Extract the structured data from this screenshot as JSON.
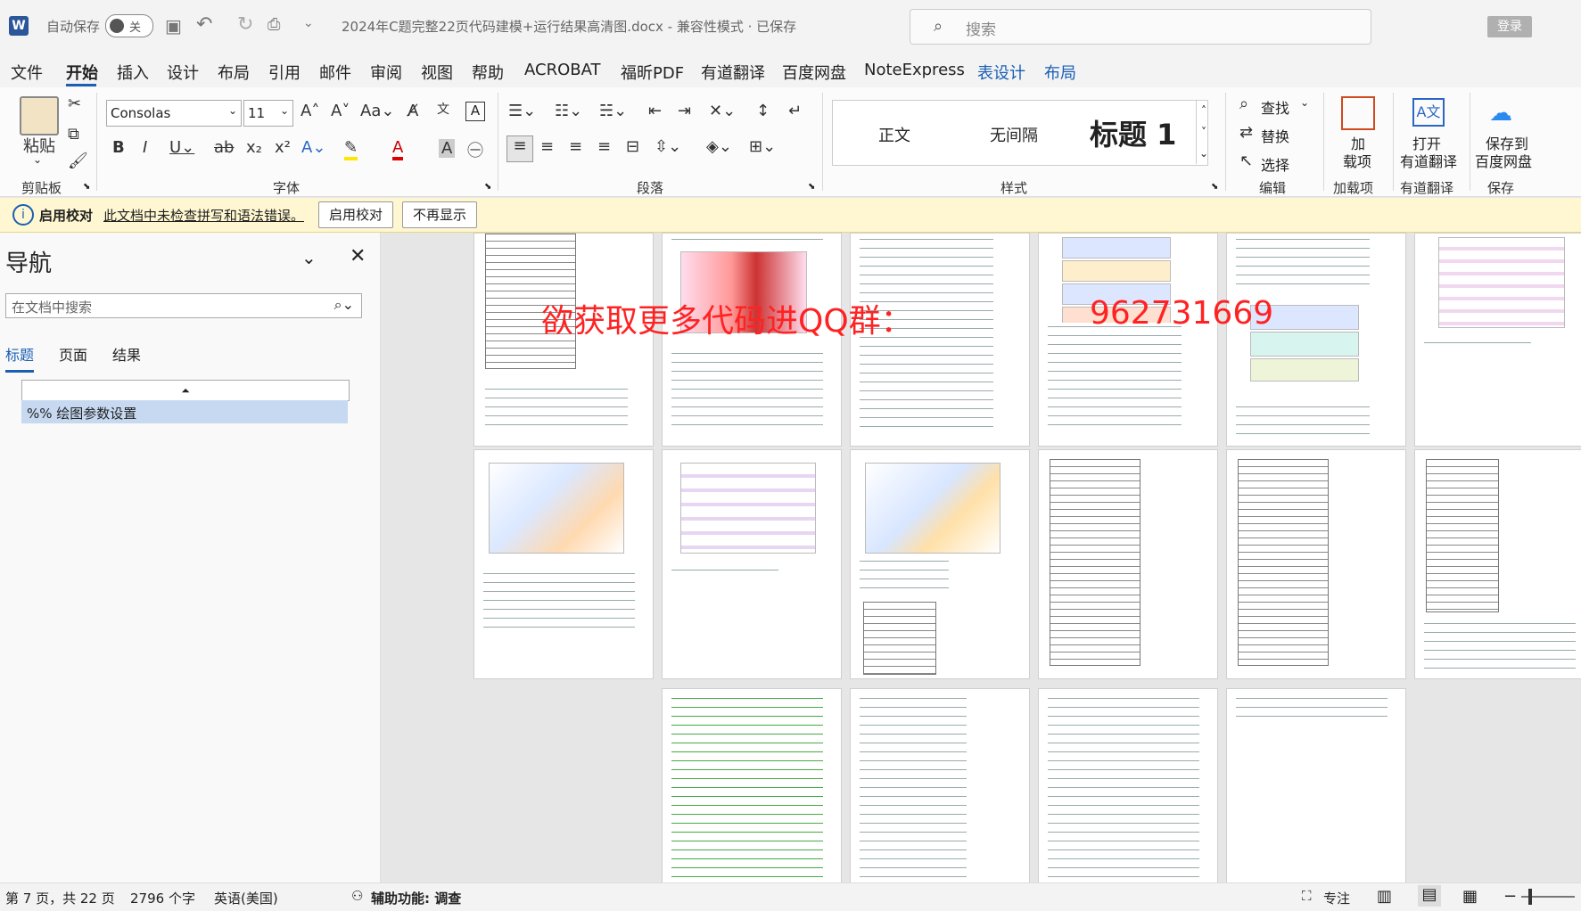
{
  "titlebar": {
    "app_icon": "W",
    "autosave_label": "自动保存",
    "autosave_state": "关",
    "doc_title": "2024年C题完整22页代码建模+运行结果高清图.docx  -  兼容性模式 · 已保存",
    "search_placeholder": "搜索",
    "login": "登录"
  },
  "menu": [
    "文件",
    "开始",
    "插入",
    "设计",
    "布局",
    "引用",
    "邮件",
    "审阅",
    "视图",
    "帮助",
    "ACROBAT",
    "福昕PDF",
    "有道翻译",
    "百度网盘",
    "NoteExpress",
    "表设计",
    "布局"
  ],
  "ribbon": {
    "paste": "粘贴",
    "clipboard_group": "剪贴板",
    "font_name": "Consolas",
    "font_size": "11",
    "font_group": "字体",
    "paragraph_group": "段落",
    "styles": [
      "正文",
      "无间隔",
      "标题 1"
    ],
    "styles_group": "样式",
    "find": "查找",
    "replace": "替换",
    "select": "选择",
    "edit_group": "编辑",
    "addin_line1": "加",
    "addin_line2": "载项",
    "addin_group": "加载项",
    "youdao_line1": "打开",
    "youdao_line2": "有道翻译",
    "youdao_group": "有道翻译",
    "baidu_line1": "保存到",
    "baidu_line2": "百度网盘",
    "baidu_group": "保存"
  },
  "infobar": {
    "title": "启用校对",
    "message": "此文档中未检查拼写和语法错误。",
    "enable_btn": "启用校对",
    "dismiss_btn": "不再显示"
  },
  "nav": {
    "title": "导航",
    "search_placeholder": "在文档中搜索",
    "tabs": [
      "标题",
      "页面",
      "结果"
    ],
    "heading_item": "%% 绘图参数设置"
  },
  "watermark": {
    "text1": "欲获取更多代码进QQ群：",
    "text2": "962731669"
  },
  "status": {
    "page": "第 7 页，共 22 页",
    "words": "2796 个字",
    "lang": "英语(美国)",
    "accessibility": "辅助功能: 调查",
    "focus": "专注"
  },
  "colors": {
    "accent": "#1a5fb4",
    "watermark": "#ff2222",
    "info_bg": "#fff7d1"
  }
}
